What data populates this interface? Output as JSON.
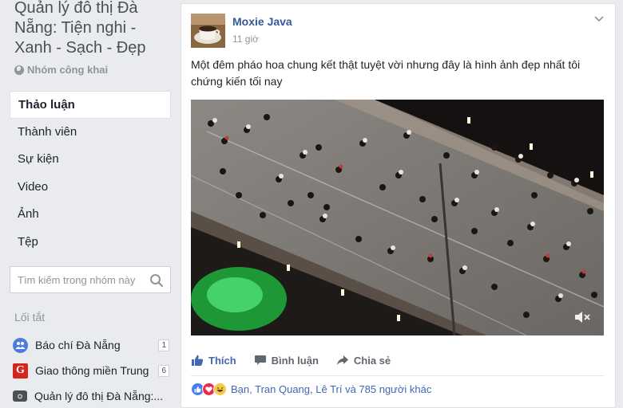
{
  "group": {
    "title": "Quản lý đô thị Đà Nẵng: Tiện nghi - Xanh - Sạch - Đẹp",
    "privacy": "Nhóm công khai"
  },
  "nav": {
    "items": [
      {
        "label": "Thảo luận",
        "active": true
      },
      {
        "label": "Thành viên"
      },
      {
        "label": "Sự kiện"
      },
      {
        "label": "Video"
      },
      {
        "label": "Ảnh"
      },
      {
        "label": "Tệp"
      }
    ]
  },
  "search": {
    "placeholder": "Tìm kiếm trong nhóm này"
  },
  "shortcuts": {
    "title": "Lối tắt",
    "items": [
      {
        "label": "Báo chí Đà Nẵng",
        "badge": "1",
        "icon": "group-icon"
      },
      {
        "label": "Giao thông miền Trung",
        "badge": "6",
        "icon": "g-logo-icon"
      },
      {
        "label": "Quản lý đô thị Đà Nẵng:...",
        "icon": "camera-icon"
      }
    ]
  },
  "post": {
    "author": "Moxie Java",
    "time": "11 giờ",
    "text": "Một đêm pháo hoa chung kết thật tuyệt vời nhưng đây là hình ảnh đẹp nhất tôi chứng kiến tối nay",
    "actions": {
      "like": "Thích",
      "comment": "Bình luận",
      "share": "Chia sẻ"
    },
    "reactions": "Bạn, Tran Quang, Lê Trí và 785 người khác"
  },
  "colors": {
    "link": "#365899",
    "like": "#4267b2",
    "background": "#e9ebee"
  }
}
